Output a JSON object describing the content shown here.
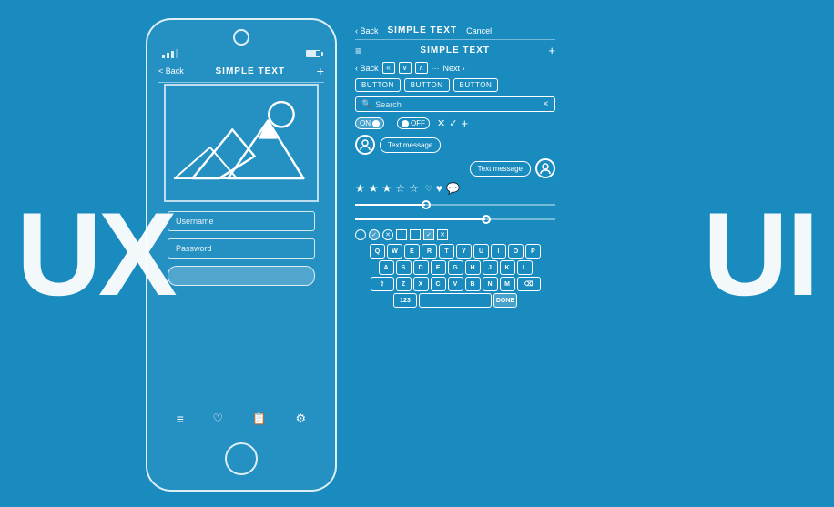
{
  "background": "#1a8bbf",
  "ux_label": "UX",
  "ui_label": "UI",
  "phone": {
    "nav": {
      "back": "< Back",
      "title": "SIMPLE TEXT",
      "plus": "+"
    },
    "image_alt": "mountain landscape",
    "username_placeholder": "Username",
    "password_placeholder": "Password",
    "bottom_icons": [
      "menu",
      "heart",
      "list",
      "settings"
    ]
  },
  "ui_panel": {
    "top_nav": {
      "back": "< Back",
      "title": "SIMPLE TEXT",
      "cancel": "Cancel"
    },
    "menu_row": {
      "menu_icon": "≡",
      "title": "SIMPLE TEXT",
      "plus": "+"
    },
    "nav_arrows": {
      "back": "< Back",
      "prev": "«",
      "down": "∨",
      "up": "∧",
      "next_label": "Next >",
      "dots": "..."
    },
    "buttons": [
      "BUTTON",
      "BUTTON",
      "BUTTON"
    ],
    "search": {
      "placeholder": "Search",
      "clear": "✕"
    },
    "toggles": {
      "on_label": "ON",
      "off_label": "OFF",
      "check": "✓",
      "cross": "✕",
      "plus": "+"
    },
    "messages": {
      "sent": "Text message",
      "received": "Text message"
    },
    "stars": {
      "filled": 3,
      "empty": 2,
      "heart_empty": true,
      "heart_full": true,
      "speech": true
    },
    "sliders": {
      "slider1_val": 35,
      "slider2_val": 65
    },
    "checkboxes": {
      "items": [
        "○",
        "✓",
        "✕",
        "□",
        "□",
        "✓",
        "✕"
      ]
    },
    "keyboard": {
      "rows": [
        [
          "Q",
          "W",
          "E",
          "R",
          "T",
          "Y",
          "U",
          "I",
          "O",
          "P"
        ],
        [
          "A",
          "S",
          "D",
          "F",
          "G",
          "H",
          "J",
          "K",
          "L"
        ],
        [
          "⇧",
          "Z",
          "X",
          "C",
          "V",
          "B",
          "N",
          "M",
          "⌫"
        ],
        [
          "123",
          " ",
          "DONE"
        ]
      ]
    }
  }
}
